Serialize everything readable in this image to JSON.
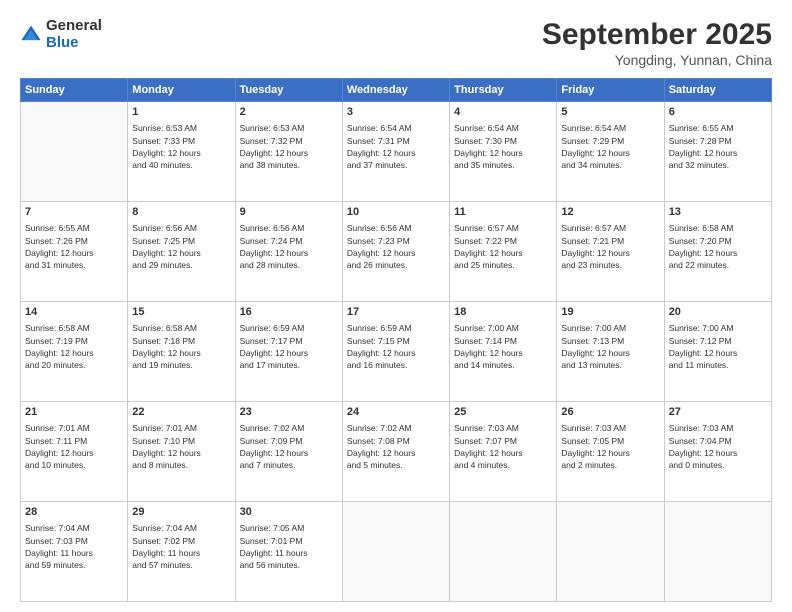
{
  "header": {
    "logo_general": "General",
    "logo_blue": "Blue",
    "month": "September 2025",
    "location": "Yongding, Yunnan, China"
  },
  "days_of_week": [
    "Sunday",
    "Monday",
    "Tuesday",
    "Wednesday",
    "Thursday",
    "Friday",
    "Saturday"
  ],
  "weeks": [
    [
      {
        "day": "",
        "info": ""
      },
      {
        "day": "1",
        "info": "Sunrise: 6:53 AM\nSunset: 7:33 PM\nDaylight: 12 hours\nand 40 minutes."
      },
      {
        "day": "2",
        "info": "Sunrise: 6:53 AM\nSunset: 7:32 PM\nDaylight: 12 hours\nand 38 minutes."
      },
      {
        "day": "3",
        "info": "Sunrise: 6:54 AM\nSunset: 7:31 PM\nDaylight: 12 hours\nand 37 minutes."
      },
      {
        "day": "4",
        "info": "Sunrise: 6:54 AM\nSunset: 7:30 PM\nDaylight: 12 hours\nand 35 minutes."
      },
      {
        "day": "5",
        "info": "Sunrise: 6:54 AM\nSunset: 7:29 PM\nDaylight: 12 hours\nand 34 minutes."
      },
      {
        "day": "6",
        "info": "Sunrise: 6:55 AM\nSunset: 7:28 PM\nDaylight: 12 hours\nand 32 minutes."
      }
    ],
    [
      {
        "day": "7",
        "info": "Sunrise: 6:55 AM\nSunset: 7:26 PM\nDaylight: 12 hours\nand 31 minutes."
      },
      {
        "day": "8",
        "info": "Sunrise: 6:56 AM\nSunset: 7:25 PM\nDaylight: 12 hours\nand 29 minutes."
      },
      {
        "day": "9",
        "info": "Sunrise: 6:56 AM\nSunset: 7:24 PM\nDaylight: 12 hours\nand 28 minutes."
      },
      {
        "day": "10",
        "info": "Sunrise: 6:56 AM\nSunset: 7:23 PM\nDaylight: 12 hours\nand 26 minutes."
      },
      {
        "day": "11",
        "info": "Sunrise: 6:57 AM\nSunset: 7:22 PM\nDaylight: 12 hours\nand 25 minutes."
      },
      {
        "day": "12",
        "info": "Sunrise: 6:57 AM\nSunset: 7:21 PM\nDaylight: 12 hours\nand 23 minutes."
      },
      {
        "day": "13",
        "info": "Sunrise: 6:58 AM\nSunset: 7:20 PM\nDaylight: 12 hours\nand 22 minutes."
      }
    ],
    [
      {
        "day": "14",
        "info": "Sunrise: 6:58 AM\nSunset: 7:19 PM\nDaylight: 12 hours\nand 20 minutes."
      },
      {
        "day": "15",
        "info": "Sunrise: 6:58 AM\nSunset: 7:18 PM\nDaylight: 12 hours\nand 19 minutes."
      },
      {
        "day": "16",
        "info": "Sunrise: 6:59 AM\nSunset: 7:17 PM\nDaylight: 12 hours\nand 17 minutes."
      },
      {
        "day": "17",
        "info": "Sunrise: 6:59 AM\nSunset: 7:15 PM\nDaylight: 12 hours\nand 16 minutes."
      },
      {
        "day": "18",
        "info": "Sunrise: 7:00 AM\nSunset: 7:14 PM\nDaylight: 12 hours\nand 14 minutes."
      },
      {
        "day": "19",
        "info": "Sunrise: 7:00 AM\nSunset: 7:13 PM\nDaylight: 12 hours\nand 13 minutes."
      },
      {
        "day": "20",
        "info": "Sunrise: 7:00 AM\nSunset: 7:12 PM\nDaylight: 12 hours\nand 11 minutes."
      }
    ],
    [
      {
        "day": "21",
        "info": "Sunrise: 7:01 AM\nSunset: 7:11 PM\nDaylight: 12 hours\nand 10 minutes."
      },
      {
        "day": "22",
        "info": "Sunrise: 7:01 AM\nSunset: 7:10 PM\nDaylight: 12 hours\nand 8 minutes."
      },
      {
        "day": "23",
        "info": "Sunrise: 7:02 AM\nSunset: 7:09 PM\nDaylight: 12 hours\nand 7 minutes."
      },
      {
        "day": "24",
        "info": "Sunrise: 7:02 AM\nSunset: 7:08 PM\nDaylight: 12 hours\nand 5 minutes."
      },
      {
        "day": "25",
        "info": "Sunrise: 7:03 AM\nSunset: 7:07 PM\nDaylight: 12 hours\nand 4 minutes."
      },
      {
        "day": "26",
        "info": "Sunrise: 7:03 AM\nSunset: 7:05 PM\nDaylight: 12 hours\nand 2 minutes."
      },
      {
        "day": "27",
        "info": "Sunrise: 7:03 AM\nSunset: 7:04 PM\nDaylight: 12 hours\nand 0 minutes."
      }
    ],
    [
      {
        "day": "28",
        "info": "Sunrise: 7:04 AM\nSunset: 7:03 PM\nDaylight: 11 hours\nand 59 minutes."
      },
      {
        "day": "29",
        "info": "Sunrise: 7:04 AM\nSunset: 7:02 PM\nDaylight: 11 hours\nand 57 minutes."
      },
      {
        "day": "30",
        "info": "Sunrise: 7:05 AM\nSunset: 7:01 PM\nDaylight: 11 hours\nand 56 minutes."
      },
      {
        "day": "",
        "info": ""
      },
      {
        "day": "",
        "info": ""
      },
      {
        "day": "",
        "info": ""
      },
      {
        "day": "",
        "info": ""
      }
    ]
  ]
}
